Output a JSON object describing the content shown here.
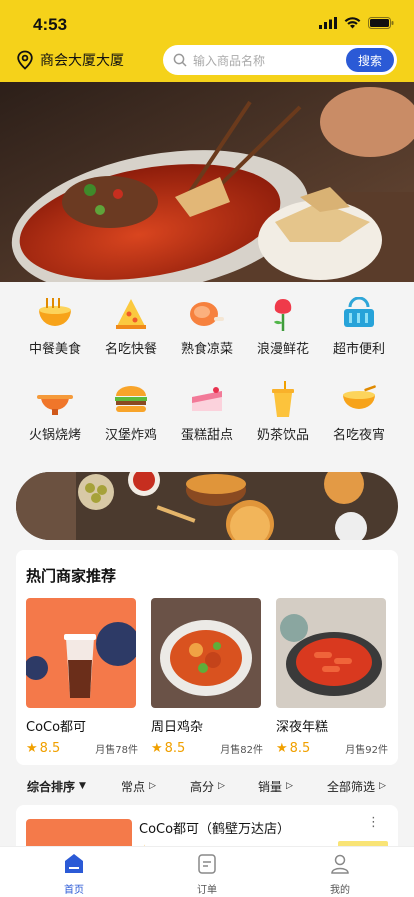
{
  "status": {
    "time": "4:53"
  },
  "header": {
    "location": "商会大厦大厦",
    "search_placeholder": "输入商品名称",
    "search_button": "搜索"
  },
  "categories": [
    {
      "label": "中餐美食",
      "icon": "noodle-bowl-icon"
    },
    {
      "label": "名吃快餐",
      "icon": "pizza-slice-icon"
    },
    {
      "label": "熟食凉菜",
      "icon": "ham-icon"
    },
    {
      "label": "浪漫鲜花",
      "icon": "rose-icon"
    },
    {
      "label": "超市便利",
      "icon": "basket-icon"
    },
    {
      "label": "火锅烧烤",
      "icon": "hotpot-icon"
    },
    {
      "label": "汉堡炸鸡",
      "icon": "burger-icon"
    },
    {
      "label": "蛋糕甜点",
      "icon": "cake-icon"
    },
    {
      "label": "奶茶饮品",
      "icon": "milk-tea-icon"
    },
    {
      "label": "名吃夜宵",
      "icon": "soup-bowl-icon"
    }
  ],
  "hot": {
    "title": "热门商家推荐",
    "shops": [
      {
        "name": "CoCo都可",
        "rating": "8.5",
        "sold": "月售78件"
      },
      {
        "name": "周日鸡杂",
        "rating": "8.5",
        "sold": "月售82件"
      },
      {
        "name": "深夜年糕",
        "rating": "8.5",
        "sold": "月售92件"
      }
    ]
  },
  "sort": {
    "items": [
      {
        "label": "综合排序",
        "arrow": "▼"
      },
      {
        "label": "常点",
        "arrow": "▷"
      },
      {
        "label": "高分",
        "arrow": "▷"
      },
      {
        "label": "销量",
        "arrow": "▷"
      },
      {
        "label": "全部筛选",
        "arrow": "▷"
      }
    ]
  },
  "list": [
    {
      "name": "CoCo都可（鹤壁万达店）",
      "more": "⋮"
    }
  ],
  "tabs": [
    {
      "label": "首页",
      "active": true
    },
    {
      "label": "订单",
      "active": false
    },
    {
      "label": "我的",
      "active": false
    }
  ],
  "colors": {
    "brand_yellow": "#f5d21a",
    "accent_blue": "#2b5ad6",
    "rating_orange": "#f0a000"
  }
}
